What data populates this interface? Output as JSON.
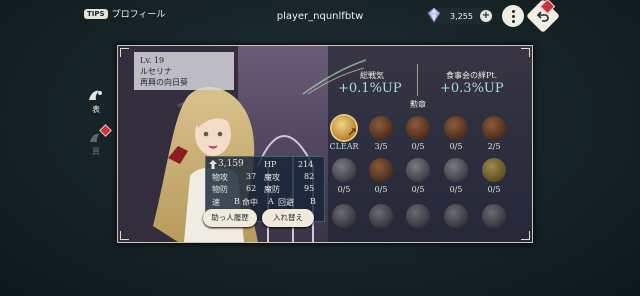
{
  "header": {
    "tips_badge": "TIPS",
    "title": "プロフィール",
    "player_name": "player_nqunlfbtw",
    "currency_value": "3,255",
    "plus_label": "+"
  },
  "side_tabs": [
    {
      "label": "表"
    },
    {
      "label": "異"
    }
  ],
  "character": {
    "level": "Lv. 19",
    "name": "ルセリナ",
    "title": "再興の向日葵"
  },
  "stats": {
    "power": "3,159",
    "hp_label": "HP",
    "hp": "214",
    "patk_label": "物攻",
    "patk": "37",
    "matk_label": "魔攻",
    "matk": "82",
    "pdef_label": "物防",
    "pdef": "62",
    "mdef_label": "魔防",
    "mdef": "95",
    "speed_label": "速",
    "speed": "B",
    "acc_label": "命中",
    "acc": "A",
    "eva_label": "回避",
    "eva": "B"
  },
  "buttons": {
    "helper_history": "助っ人履歴",
    "swap": "入れ替え"
  },
  "summary": {
    "total_label": "総戦気",
    "total_value": "+0.1%UP",
    "bond_label": "食事会の絆Pt.",
    "bond_value": "+0.3%UP"
  },
  "medals": {
    "heading": "勲章",
    "row1": [
      "CLEAR",
      "3/5",
      "0/5",
      "0/5",
      "2/5"
    ],
    "row2": [
      "0/5",
      "0/5",
      "0/5",
      "0/5",
      "0/5"
    ]
  },
  "colors": {
    "accent_blue": "#a9d9e6",
    "badge_red": "#c8323c",
    "panel_border": "#cfc8b0"
  }
}
